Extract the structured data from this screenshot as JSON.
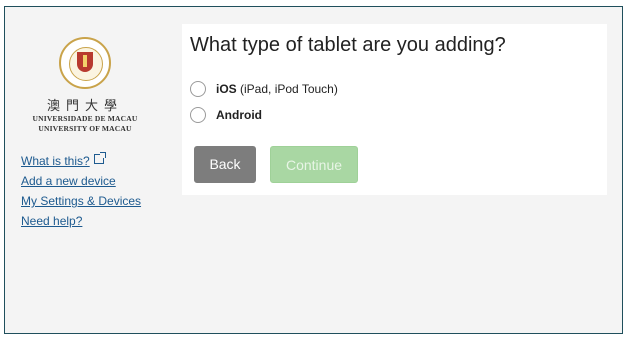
{
  "logo": {
    "chinese": "澳門大學",
    "portuguese": "UNIVERSIDADE DE MACAU",
    "english": "UNIVERSITY OF MACAU"
  },
  "sidebar": {
    "links": [
      {
        "label": "What is this?",
        "icon": "external-link-icon"
      },
      {
        "label": "Add a new device"
      },
      {
        "label": "My Settings & Devices"
      },
      {
        "label": "Need help?"
      }
    ]
  },
  "main": {
    "title": "What type of tablet are you adding?",
    "options": [
      {
        "bold": "iOS",
        "detail": " (iPad, iPod Touch)",
        "selected": false
      },
      {
        "bold": "Android",
        "detail": "",
        "selected": false
      }
    ],
    "buttons": {
      "back": "Back",
      "continue": "Continue"
    }
  },
  "colors": {
    "link": "#1d5a8f",
    "back_button": "#7d7d7d",
    "continue_disabled": "#a9d7a3",
    "frame_border": "#1f4f5c"
  }
}
